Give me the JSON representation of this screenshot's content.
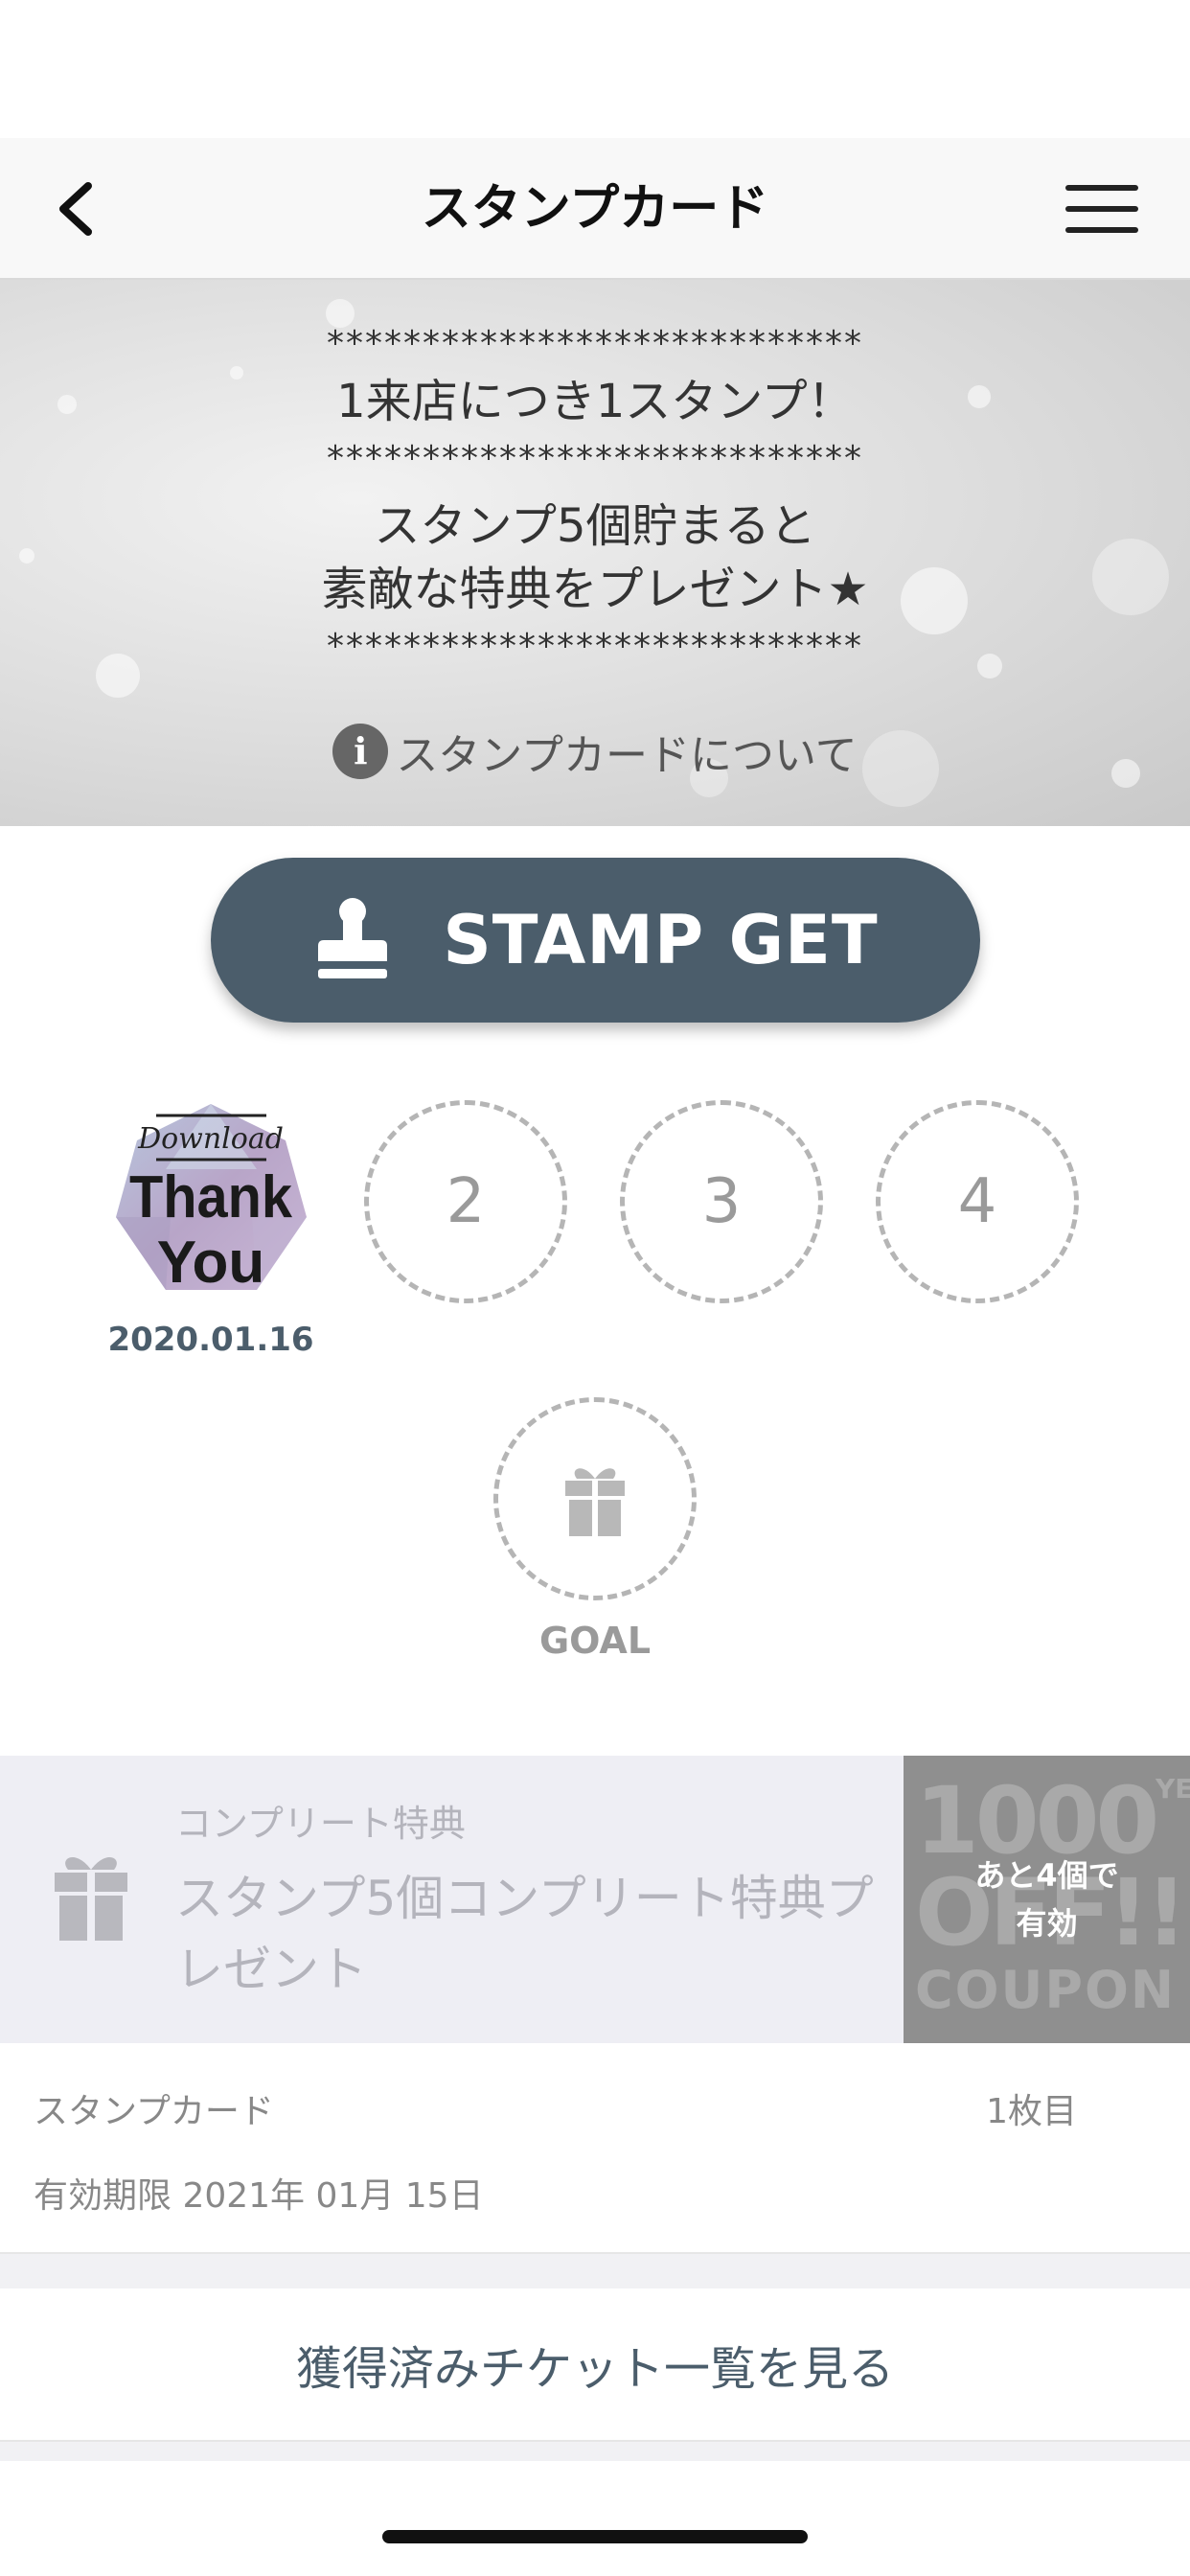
{
  "nav": {
    "title": "スタンプカード",
    "back_icon": "chevron-left-icon",
    "menu_icon": "hamburger-menu-icon"
  },
  "banner": {
    "stars": "****************************",
    "line1": "1来店につき1スタンプ！",
    "line2": "スタンプ5個貯まると",
    "line3": "素敵な特典をプレゼント★",
    "info_link": "スタンプカードについて",
    "info_icon": "info-icon"
  },
  "stamp_button": {
    "label": "STAMP GET",
    "icon": "stamp-icon"
  },
  "stamps": {
    "first": {
      "download": "Download",
      "thank": "Thank",
      "you": "You",
      "date": "2020.01.16"
    },
    "slots": [
      "2",
      "3",
      "4"
    ],
    "goal_label": "GOAL",
    "goal_icon": "gift-icon"
  },
  "reward": {
    "small_label": "コンプリート特典",
    "title": "スタンプ5個コンプリート特典プレゼント",
    "coupon_line1": "あと4個で",
    "coupon_line2": "有効",
    "coupon_bg1": "1000",
    "coupon_bg2": "OFF!!",
    "coupon_bg3": "COUPON",
    "coupon_yen": "YEN"
  },
  "card_info": {
    "label": "スタンプカード",
    "count": "1枚目",
    "expiry": "有効期限 2021年 01月 15日"
  },
  "tickets_button": {
    "label": "獲得済みチケット一覧を見る"
  },
  "colors": {
    "accent": "#4b5d6b",
    "nav_bg": "#f8f8f8",
    "reward_bg": "#eeeef4"
  }
}
